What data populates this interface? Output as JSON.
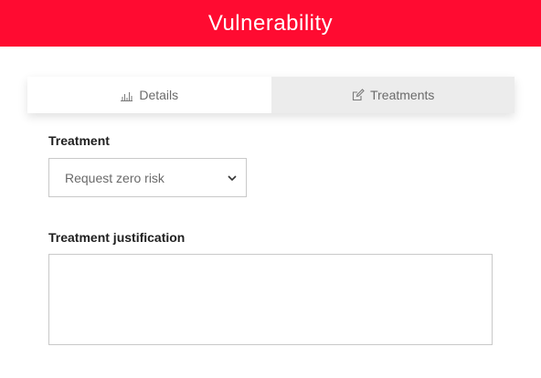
{
  "colors": {
    "brand_red": "#ff0b31",
    "inactive_tab_bg": "#ececec",
    "border": "#c9c9c9"
  },
  "header": {
    "title": "Vulnerability"
  },
  "tabs": [
    {
      "label": "Details",
      "icon": "bar-chart-icon",
      "active": true
    },
    {
      "label": "Treatments",
      "icon": "edit-icon",
      "active": false
    }
  ],
  "form": {
    "treatment": {
      "label": "Treatment",
      "selected_value": "Request zero risk"
    },
    "justification": {
      "label": "Treatment justification",
      "value": ""
    }
  }
}
